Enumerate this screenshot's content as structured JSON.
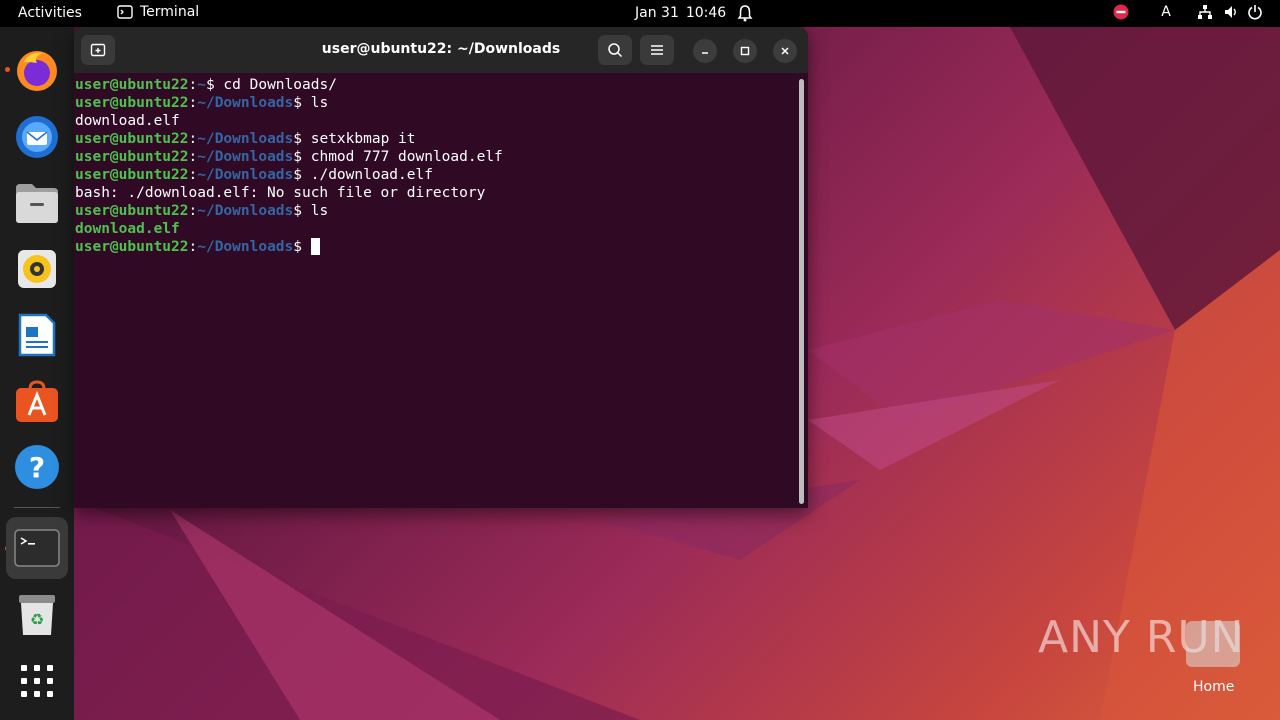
{
  "topbar": {
    "activities": "Activities",
    "app_name": "Terminal",
    "date": "Jan 31",
    "time": "10:46",
    "input_source": "A"
  },
  "dock": {
    "items": [
      "firefox-icon",
      "thunderbird-icon",
      "files-icon",
      "rhythmbox-icon",
      "libreoffice-writer-icon",
      "app-center-icon",
      "help-icon",
      "terminal-icon",
      "trash-icon",
      "show-apps-icon"
    ]
  },
  "terminal": {
    "title": "user@ubuntu22: ~/Downloads",
    "prompt_user": "user@ubuntu22",
    "lines": [
      {
        "type": "prompt",
        "path": "~",
        "cmd": " cd Downloads/"
      },
      {
        "type": "prompt",
        "path": "~/Downloads",
        "cmd": " ls"
      },
      {
        "type": "output",
        "text": "download.elf",
        "bold": false
      },
      {
        "type": "prompt",
        "path": "~/Downloads",
        "cmd": " setxkbmap it"
      },
      {
        "type": "prompt",
        "path": "~/Downloads",
        "cmd": " chmod 777 download.elf"
      },
      {
        "type": "prompt",
        "path": "~/Downloads",
        "cmd": " ./download.elf"
      },
      {
        "type": "output",
        "text": "bash: ./download.elf: No such file or directory",
        "bold": false
      },
      {
        "type": "prompt",
        "path": "~/Downloads",
        "cmd": " ls"
      },
      {
        "type": "output",
        "text": "download.elf",
        "bold": true
      },
      {
        "type": "prompt",
        "path": "~/Downloads",
        "cmd": " ",
        "cursor": true
      }
    ]
  },
  "desktop": {
    "watermark": "ANY RUN",
    "home_label": "Home"
  },
  "colors": {
    "terminal_bg": "#300a24",
    "prompt_user": "#4ec24e",
    "prompt_path": "#3465a4",
    "accent": "#e95420"
  }
}
